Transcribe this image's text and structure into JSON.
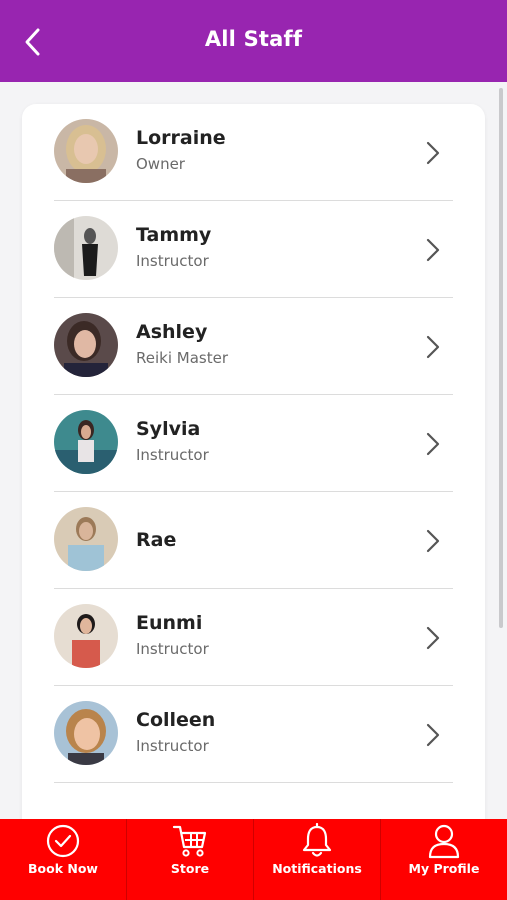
{
  "header": {
    "title": "All Staff",
    "back_icon": "chevron-left-icon"
  },
  "staff": [
    {
      "name": "Lorraine",
      "role": "Owner"
    },
    {
      "name": "Tammy",
      "role": "Instructor"
    },
    {
      "name": "Ashley",
      "role": "Reiki Master"
    },
    {
      "name": "Sylvia",
      "role": "Instructor"
    },
    {
      "name": "Rae",
      "role": ""
    },
    {
      "name": "Eunmi",
      "role": "Instructor"
    },
    {
      "name": "Colleen",
      "role": "Instructor"
    }
  ],
  "tabbar": {
    "items": [
      {
        "label": "Book Now",
        "icon": "check-circle-icon"
      },
      {
        "label": "Store",
        "icon": "cart-icon"
      },
      {
        "label": "Notifications",
        "icon": "bell-icon"
      },
      {
        "label": "My Profile",
        "icon": "user-icon"
      }
    ]
  },
  "colors": {
    "header_bg": "#9825b0",
    "tabbar_bg": "#ff0000",
    "text": "#222222",
    "muted": "#6a6a6a"
  }
}
